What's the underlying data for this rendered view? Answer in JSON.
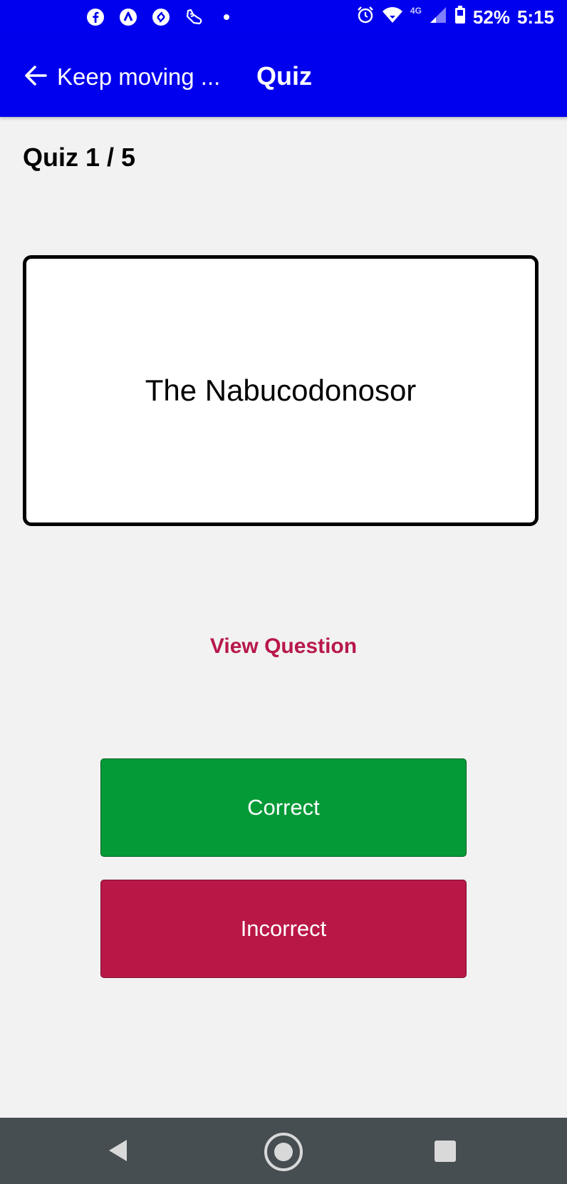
{
  "status_bar": {
    "icons_left": [
      "facebook-icon",
      "arc-icon",
      "shazam-icon",
      "shoe-icon",
      "notification-dot-icon"
    ],
    "network": "4G",
    "battery": "52%",
    "time": "5:15"
  },
  "app_bar": {
    "back_label": "Keep moving ...",
    "title": "Quiz"
  },
  "quiz": {
    "progress": "Quiz 1 / 5",
    "card_text": "The Nabucodonosor",
    "view_question_label": "View Question",
    "correct_label": "Correct",
    "incorrect_label": "Incorrect"
  },
  "colors": {
    "app_bar": "#0000ee",
    "correct": "#039a37",
    "incorrect": "#b91846",
    "link": "#b8184a",
    "background": "#f2f2f2",
    "nav_bar": "#464e52"
  }
}
